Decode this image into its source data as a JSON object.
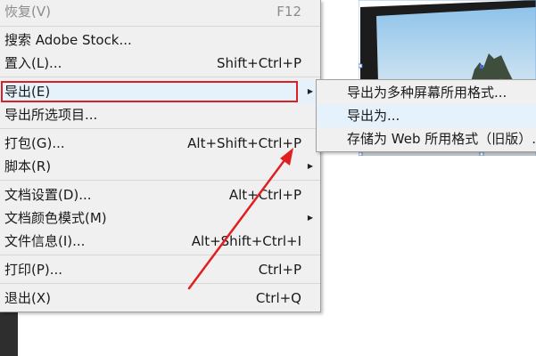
{
  "menu": {
    "items": [
      {
        "label": "恢复(V)",
        "shortcut": "F12",
        "disabled": true
      },
      {
        "label": "搜索 Adobe Stock...",
        "shortcut": ""
      },
      {
        "label": "置入(L)...",
        "shortcut": "Shift+Ctrl+P"
      },
      {
        "label": "导出(E)",
        "shortcut": "",
        "submenu": true,
        "selected": true
      },
      {
        "label": "导出所选项目...",
        "shortcut": ""
      },
      {
        "label": "打包(G)...",
        "shortcut": "Alt+Shift+Ctrl+P"
      },
      {
        "label": "脚本(R)",
        "shortcut": "",
        "submenu": true
      },
      {
        "label": "文档设置(D)...",
        "shortcut": "Alt+Ctrl+P"
      },
      {
        "label": "文档颜色模式(M)",
        "shortcut": "",
        "submenu": true
      },
      {
        "label": "文件信息(I)...",
        "shortcut": "Alt+Shift+Ctrl+I"
      },
      {
        "label": "打印(P)...",
        "shortcut": "Ctrl+P"
      },
      {
        "label": "退出(X)",
        "shortcut": "Ctrl+Q"
      }
    ]
  },
  "submenu": {
    "items": [
      {
        "label": "导出为多种屏幕所用格式..."
      },
      {
        "label": "导出为..."
      },
      {
        "label": "存储为 Web 所用格式（旧版）..."
      }
    ]
  },
  "icons": {
    "submenu_arrow": "caret-right-icon"
  },
  "colors": {
    "menu_bg": "#f0f0f0",
    "highlight": "#e5f1fb",
    "annotation_red": "#e02020",
    "disabled_text": "#8c8c8c"
  }
}
